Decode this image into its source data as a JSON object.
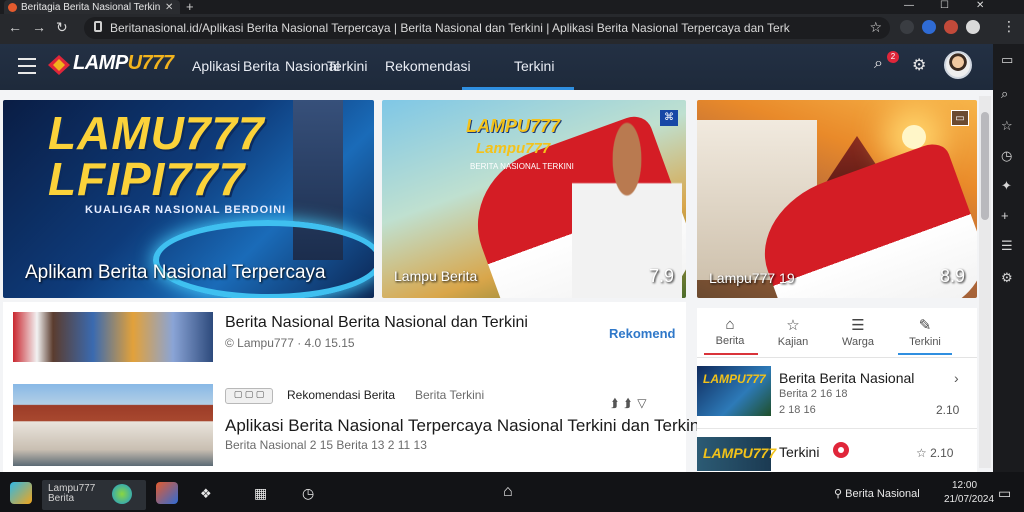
{
  "browser": {
    "tab_title": "Beritagia Berita Nasional Terkini",
    "address": "Beritanasional.id/Aplikasi Berita Nasional Terpercaya | Berita Nasional dan Terkini | Aplikasi Berita Nasional Terpercaya dan Terkini",
    "new_tab": "+",
    "window_controls": [
      "—",
      "☐",
      "✕"
    ]
  },
  "site": {
    "logo_main": "LAMP",
    "logo_accent": "U777",
    "nav": [
      "Aplikasi",
      "Berita",
      "Nasional",
      "Terkini",
      "Rekomendasi",
      "Terkini"
    ],
    "notif_count": "2"
  },
  "hero": [
    {
      "title_line1": "LAMU777",
      "title_line2": "LFIPI777",
      "subtitle": "KUALIGAR NASIONAL BERDOINI",
      "caption": "Aplikam Berita Nasional Terpercaya"
    },
    {
      "logo": "LAMPU777",
      "logo_sub": "Lampu777",
      "small": "BERITA NASIONAL TERKINI",
      "caption": "Lampu Berita",
      "score": "7.9",
      "badge": "⌘"
    },
    {
      "caption": "Lampu777 19",
      "score": "8.9",
      "badge": "▭"
    }
  ],
  "list": [
    {
      "title": "Berita Nasional Berita Nasional dan Terkini",
      "meta": "© Lampu777 · 4.0 15.15",
      "link": "Rekomend"
    },
    {
      "tag": "▢ ▢ ▢",
      "kicker": "Rekomendasi Berita",
      "kicker2": "Berita Terkini",
      "title": "Aplikasi Berita Nasional Terpercaya Nasional Terkini dan Terkini",
      "meta": "Berita Nasional 2 15 Berita 13 2 11 13"
    }
  ],
  "rpanel": {
    "tabs": [
      {
        "icon": "⌂",
        "label": "Berita"
      },
      {
        "icon": "☆",
        "label": "Kajian"
      },
      {
        "icon": "☰",
        "label": "Warga"
      },
      {
        "icon": "✎",
        "label": "Terkini"
      }
    ],
    "items": [
      {
        "thumb": "LAMPU777",
        "title": "Berita Berita Nasional",
        "meta1": "Berita 2 16 18",
        "meta2": "2 18 16",
        "num": "2.10"
      },
      {
        "thumb": "LAMPU777",
        "title": "Terkini",
        "num": "☆ 2.10"
      }
    ]
  },
  "taskbar": {
    "active_label": "Lampu777\nBerita",
    "items": [
      "❖",
      "▦",
      "⚙",
      "▭",
      "◷"
    ],
    "center_home": "⌂",
    "tray": "⚲ Berita Nasional",
    "time": "12:00",
    "date": "21/07/2024"
  },
  "colors": {
    "header_bg": "#233044",
    "accent_blue": "#2f8fe0",
    "accent_red": "#e0263a",
    "logo_yellow": "#f2b31d"
  }
}
